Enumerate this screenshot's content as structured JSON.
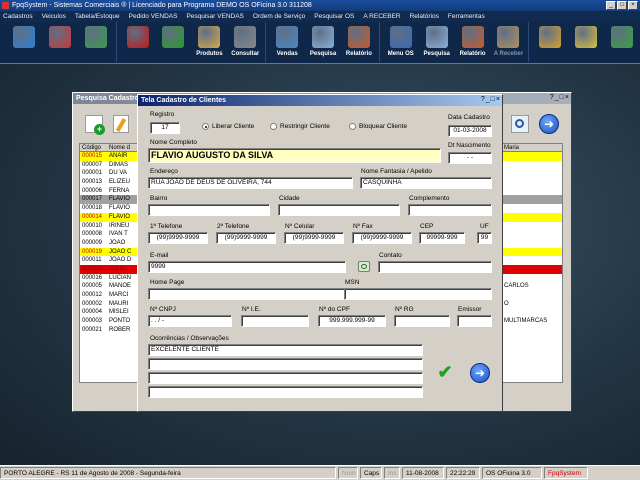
{
  "app": {
    "title": "FpqSystem - Sistemas Comerciais ® | Licenciado para  Programa DEMO OS OFicina 3.0 311208"
  },
  "menu": [
    "Cadastros",
    "Veiculos",
    "Tabela/Estoque",
    "Pedido VENDAS",
    "Pesquisar VENDAS",
    "Ordem de Serviço",
    "Pesquisar OS",
    "A RECEBER",
    "Relatórios",
    "Ferramentas"
  ],
  "toolbar": [
    {
      "label": "",
      "icon": "user-icon",
      "color": "#2d7fd3"
    },
    {
      "label": "",
      "icon": "user-icon",
      "color": "#c43a3a"
    },
    {
      "label": "",
      "icon": "user-icon",
      "color": "#3a9a4a"
    },
    {
      "label": "",
      "icon": "car-icon",
      "color": "#c01818"
    },
    {
      "label": "",
      "icon": "clock-icon",
      "color": "#2a9a2a"
    },
    {
      "label": "Produtos",
      "icon": "boxes-icon",
      "color": "#d9a84a"
    },
    {
      "label": "Consultar",
      "icon": "tape-icon",
      "color": "#888888"
    },
    {
      "label": "Vendas",
      "icon": "monitor-icon",
      "color": "#4a88c8"
    },
    {
      "label": "Pesquisa",
      "icon": "search-doc-icon",
      "color": "#8ab0d8"
    },
    {
      "label": "Relatório",
      "icon": "report-icon",
      "color": "#c85a2a"
    },
    {
      "label": "Menu OS",
      "icon": "menu-os-icon",
      "color": "#3a6ab0"
    },
    {
      "label": "Pesquisa",
      "icon": "search-doc-icon",
      "color": "#8ab0d8"
    },
    {
      "label": "Relatório",
      "icon": "report-icon",
      "color": "#c85a2a"
    },
    {
      "label": "A Receber",
      "icon": "money-icon",
      "color": "#b09060"
    },
    {
      "label": "",
      "icon": "calculator-icon",
      "color": "#d8a030"
    },
    {
      "label": "",
      "icon": "coins-icon",
      "color": "#d8c040"
    },
    {
      "label": "",
      "icon": "exit-icon",
      "color": "#3aa040"
    }
  ],
  "back_window": {
    "title": "Pesquisa Cadastro",
    "col_codigo": "Código",
    "col_nome": "Nome d",
    "right_header": "Maria",
    "rows": [
      {
        "code": "000015",
        "name": "ANAIR",
        "style": "y",
        "right": ""
      },
      {
        "code": "000007",
        "name": "DIMAS",
        "style": "",
        "right": ""
      },
      {
        "code": "000001",
        "name": "DU VA",
        "style": "",
        "right": ""
      },
      {
        "code": "000013",
        "name": "ELIZEU",
        "style": "",
        "right": ""
      },
      {
        "code": "000006",
        "name": "FERNA",
        "style": "",
        "right": ""
      },
      {
        "code": "000017",
        "name": "FLAVIO",
        "style": "g",
        "right": ""
      },
      {
        "code": "000018",
        "name": "FLAVIO",
        "style": "",
        "right": ""
      },
      {
        "code": "000014",
        "name": "FLAVIO",
        "style": "y",
        "right": ""
      },
      {
        "code": "000010",
        "name": "IRINEU",
        "style": "",
        "right": ""
      },
      {
        "code": "000008",
        "name": "IVAN T",
        "style": "",
        "right": ""
      },
      {
        "code": "000009",
        "name": "JOÃO",
        "style": "",
        "right": ""
      },
      {
        "code": "000019",
        "name": "JOÃO C",
        "style": "y",
        "right": ""
      },
      {
        "code": "000011",
        "name": "JOÃO D",
        "style": "",
        "right": ""
      },
      {
        "code": "000003",
        "name": "JULIA",
        "style": "r",
        "right": ""
      },
      {
        "code": "000016",
        "name": "LUCIAN",
        "style": "",
        "right": ""
      },
      {
        "code": "000005",
        "name": "MANOE",
        "style": "",
        "right": "CARLOS"
      },
      {
        "code": "000012",
        "name": "MARCI",
        "style": "",
        "right": ""
      },
      {
        "code": "000002",
        "name": "MAURI",
        "style": "",
        "right": "O"
      },
      {
        "code": "000004",
        "name": "MISLEI",
        "style": "",
        "right": ""
      },
      {
        "code": "000003",
        "name": "PONTO",
        "style": "",
        "right": "MULTIMARCAS"
      },
      {
        "code": "000021",
        "name": "ROBER",
        "style": "",
        "right": ""
      }
    ]
  },
  "form": {
    "title": "Tela Cadastro de Clientes",
    "registro_label": "Registro",
    "registro": "17",
    "radio_liberar": "Liberar Cliente",
    "radio_restringir": "Restringir Cliente",
    "radio_bloquear": "Bloquear Cliente",
    "data_cadastro_label": "Data Cadastro",
    "data_cadastro": "01-03-2008",
    "nome_label": "Nome Completo",
    "nome": "FLAVIO AUGUSTO DA SILVA",
    "dt_nasc_label": "Dt Nascimento",
    "dt_nasc": "- -",
    "endereco_label": "Endereço",
    "endereco": "RUA JOÃO DE DEUS DE OLIVEIRA, 744",
    "fantasia_label": "Nome Fantasia / Apelido",
    "fantasia": "CASQUINHA",
    "bairro_label": "Bairro",
    "bairro": "",
    "cidade_label": "Cidade",
    "cidade": "",
    "complemento_label": "Complemento",
    "complemento": "",
    "tel1_label": "1ª Telefone",
    "tel1": "(99)9999-9999",
    "tel2_label": "2ª Telefone",
    "tel2": "(99)9999-9999",
    "cel_label": "Nº Celular",
    "cel": "(99)9999-9999",
    "fax_label": "Nº Fax",
    "fax": "(99)9999-9999",
    "cep_label": "CEP",
    "cep": "99999-999",
    "uf_label": "UF",
    "uf": "99",
    "email_label": "E-mail",
    "email": "9999",
    "contato_label": "Contato",
    "contato": "",
    "homepage_label": "Home Page",
    "homepage": "",
    "msn_label": "MSN",
    "msn": "",
    "cnpj_label": "Nº CNPJ",
    "cnpj": "  .    .    /    -",
    "ie_label": "Nº I.E.",
    "ie": "",
    "cpf_label": "Nº do CPF",
    "cpf": "999.999.999-99",
    "rg_label": "Nº RG",
    "rg": "",
    "emissor_label": "Emissor",
    "emissor": "",
    "obs_label": "Ocorrências / Observações",
    "obs": [
      "EXCELENTE CLIENTE",
      "",
      "",
      ""
    ]
  },
  "status": {
    "location": "PORTO ALEGRE - RS 11 de Agosto de 2008 - Segunda-feira",
    "num": "Num",
    "caps": "Caps",
    "ins": "Ins",
    "date": "11-08-2008",
    "time": "22:22:29",
    "product": "OS OFicina 3.0",
    "brand": "FpqSystem"
  }
}
